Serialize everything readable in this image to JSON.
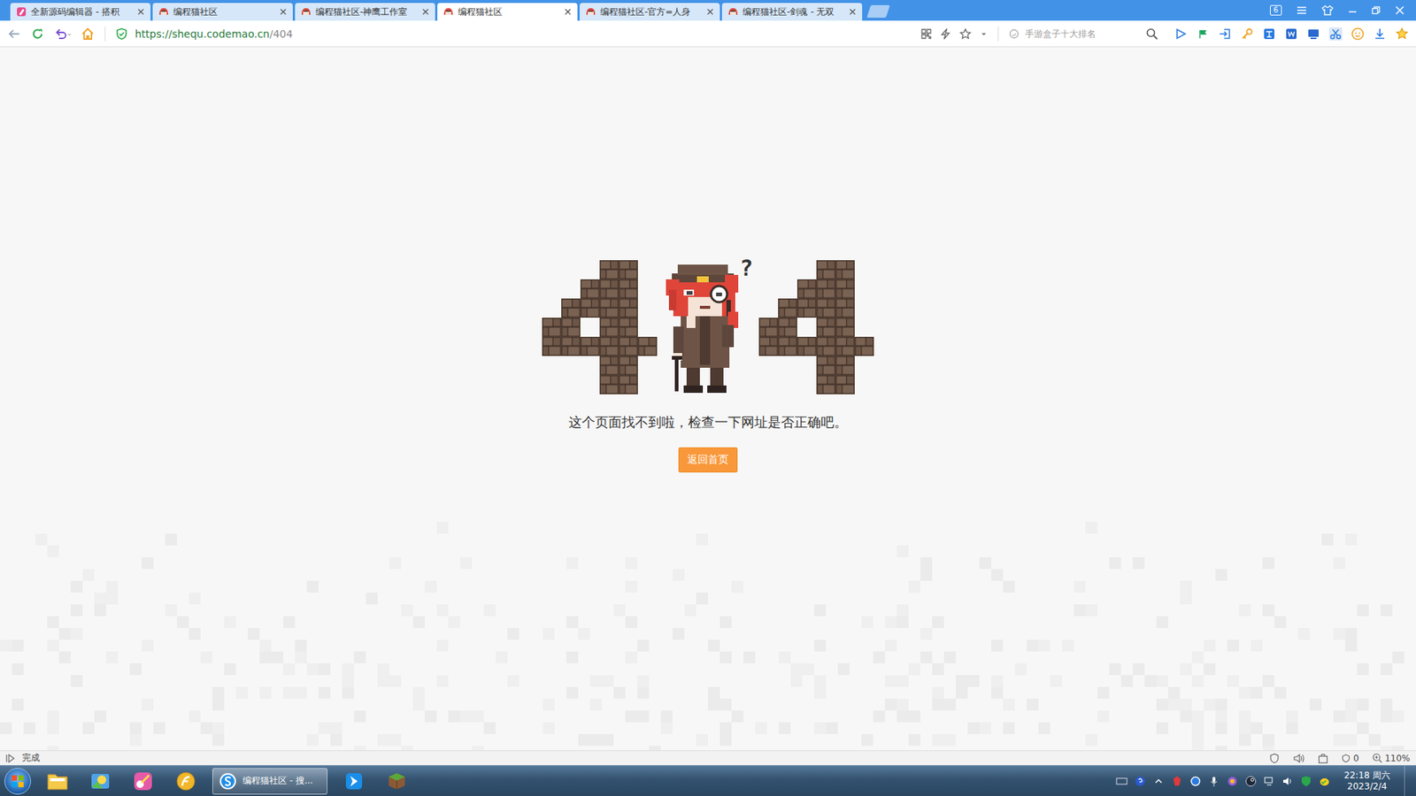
{
  "tabs": [
    {
      "label": "全新源码编辑器 - 搭积",
      "selected": false
    },
    {
      "label": "编程猫社区",
      "selected": false
    },
    {
      "label": "编程猫社区-神鹰工作室",
      "selected": false
    },
    {
      "label": "编程猫社区",
      "selected": true
    },
    {
      "label": "编程猫社区-官方=人身",
      "selected": false
    },
    {
      "label": "编程猫社区-剑魂 - 无双",
      "selected": false
    }
  ],
  "window_badge": "6",
  "toolbar": {
    "url_host": "https://shequ.codemao.cn",
    "url_path": "/404",
    "search_placeholder": "手游盒子十大排名"
  },
  "page": {
    "figure_mark": "?",
    "message": "这个页面找不到啦，检查一下网址是否正确吧。",
    "button": "返回首页"
  },
  "status_bar": {
    "text": "完成",
    "blocked_count": "0",
    "zoom": "110%"
  },
  "taskbar": {
    "tasks": [
      {
        "label": "编程猫社区 - 搜...",
        "active": true
      }
    ],
    "clock": {
      "time": "22:18 周六",
      "date": "2023/2/4"
    }
  }
}
